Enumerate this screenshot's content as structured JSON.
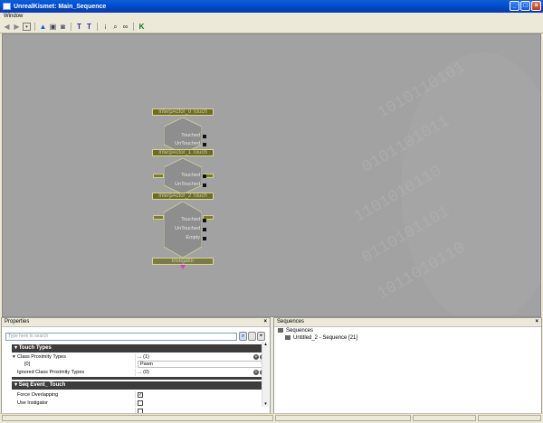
{
  "window": {
    "title": "UnrealKismet: Main_Sequence"
  },
  "menu": {
    "window_label": "Window"
  },
  "toolbar": {
    "icons": [
      "back-arrow-icon",
      "forward-arrow-icon",
      "dropdown-icon",
      "up-arrow-icon",
      "open-parent-icon",
      "screenshot-icon",
      "T-icon",
      "T-plus-icon",
      "info-icon",
      "search-icon",
      "link-icon",
      "K-icon"
    ]
  },
  "graph": {
    "nodes": [
      {
        "title": "InterpActor_0 Touch",
        "outputs": [
          "Touched",
          "UnTouched"
        ]
      },
      {
        "title": "InterpActor_1 Touch",
        "outputs": [
          "Touched",
          "UnTouched"
        ]
      },
      {
        "title": "InterpActor_2 Touch",
        "outputs": [
          "Touched",
          "UnTouched",
          "Empty"
        ]
      }
    ],
    "variable_label": "Instigator"
  },
  "properties": {
    "header": "Properties",
    "close": "×",
    "search_placeholder": "Type here to search",
    "categories": [
      {
        "name": "Touch Types"
      },
      {
        "name": "Seq Event_ Touch"
      }
    ],
    "rows": [
      {
        "key": "Class Proximity Types",
        "value": "... (1)"
      },
      {
        "key": "[0]",
        "value": "Pawn"
      },
      {
        "key": "Ignored Class Proximity Types",
        "value": "... (0)"
      },
      {
        "key": "Force Overlapping",
        "checked": true,
        "check_glyph": "✓"
      },
      {
        "key": "Use Instigator",
        "checked": false,
        "check_glyph": ""
      }
    ]
  },
  "sequences": {
    "header": "Sequences",
    "close": "×",
    "tree": [
      "Sequences",
      "Untitled_2 - Sequence [21]"
    ]
  }
}
